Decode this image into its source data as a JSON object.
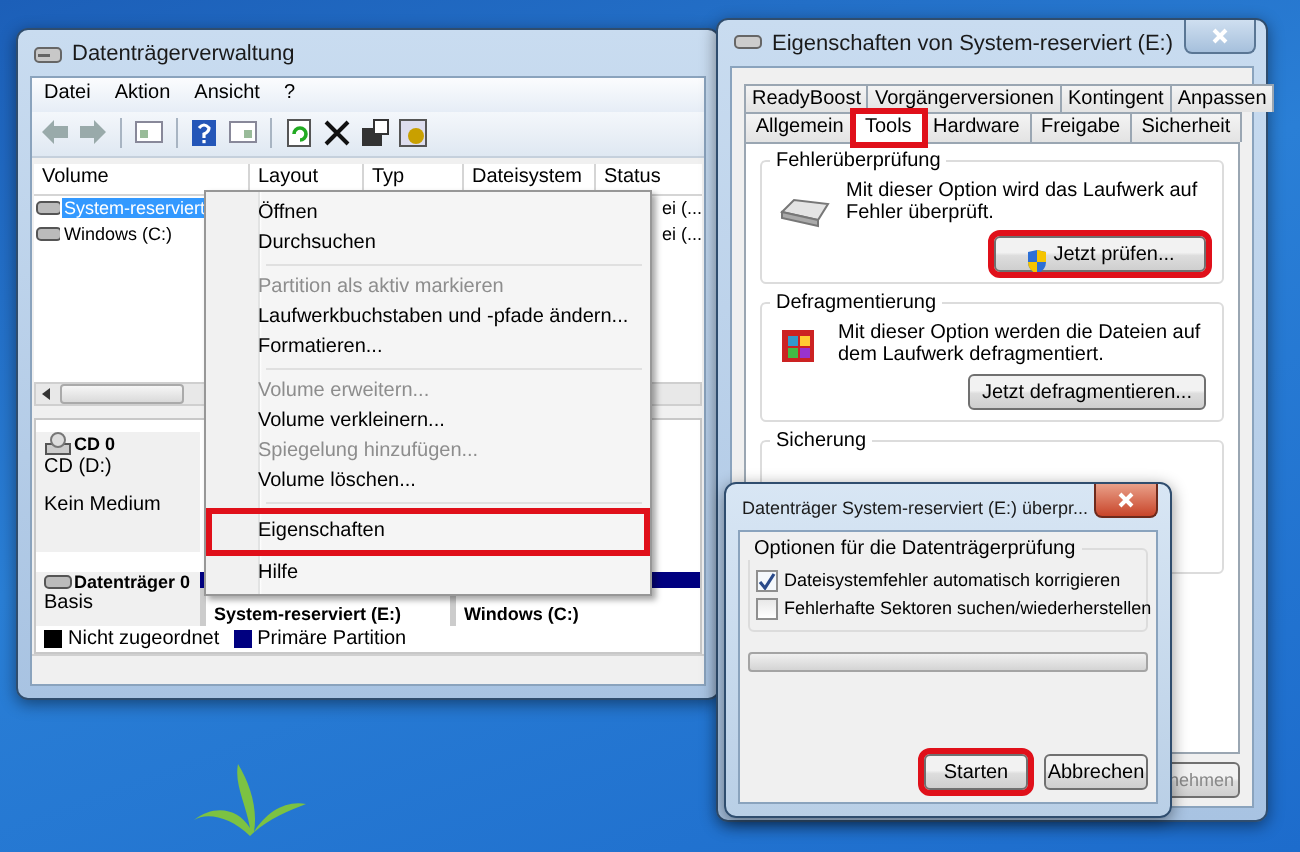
{
  "disk_management": {
    "title": "Datenträgerverwaltung",
    "menu": [
      "Datei",
      "Aktion",
      "Ansicht",
      "?"
    ],
    "table": {
      "columns": [
        "Volume",
        "Layout",
        "Typ",
        "Dateisystem",
        "Status"
      ],
      "rows": [
        {
          "volume": "System-reserviert",
          "status": "ei (...",
          "selected": true
        },
        {
          "volume": "Windows (C:)",
          "status": "ei (...",
          "selected": false
        }
      ]
    },
    "disks": [
      {
        "kind": "cd",
        "name": "CD 0",
        "lines": [
          "CD (D:)",
          "Kein Medium"
        ]
      },
      {
        "kind": "disk",
        "name": "Datenträger 0",
        "lines": [
          "Basis"
        ],
        "partitions": [
          "System-reserviert (E:)",
          "Windows (C:)"
        ]
      }
    ],
    "legend": [
      {
        "label": "Nicht zugeordnet",
        "color": "#000000"
      },
      {
        "label": "Primäre Partition",
        "color": "#000080"
      }
    ]
  },
  "context_menu": {
    "items": [
      {
        "kind": "item",
        "label": "Öffnen",
        "disabled": false,
        "highlighted": false
      },
      {
        "kind": "item",
        "label": "Durchsuchen",
        "disabled": false,
        "highlighted": false
      },
      {
        "kind": "separator"
      },
      {
        "kind": "item",
        "label": "Partition als aktiv markieren",
        "disabled": true,
        "highlighted": false
      },
      {
        "kind": "item",
        "label": "Laufwerkbuchstaben und -pfade ändern...",
        "disabled": false,
        "highlighted": false
      },
      {
        "kind": "item",
        "label": "Formatieren...",
        "disabled": false,
        "highlighted": false
      },
      {
        "kind": "separator"
      },
      {
        "kind": "item",
        "label": "Volume erweitern...",
        "disabled": true,
        "highlighted": false
      },
      {
        "kind": "item",
        "label": "Volume verkleinern...",
        "disabled": false,
        "highlighted": false
      },
      {
        "kind": "item",
        "label": "Spiegelung hinzufügen...",
        "disabled": true,
        "highlighted": false
      },
      {
        "kind": "item",
        "label": "Volume löschen...",
        "disabled": false,
        "highlighted": false
      },
      {
        "kind": "separator"
      },
      {
        "kind": "item",
        "label": "Eigenschaften",
        "disabled": false,
        "highlighted": true
      },
      {
        "kind": "item",
        "label": "Hilfe",
        "disabled": false,
        "highlighted": false
      }
    ]
  },
  "properties": {
    "title": "Eigenschaften von System-reserviert (E:)",
    "tab_rows": [
      [
        {
          "label": "ReadyBoost",
          "selected": false,
          "highlighted": false
        },
        {
          "label": "Vorgängerversionen",
          "selected": false,
          "highlighted": false
        },
        {
          "label": "Kontingent",
          "selected": false,
          "highlighted": false
        },
        {
          "label": "Anpassen",
          "selected": false,
          "highlighted": false
        }
      ],
      [
        {
          "label": "Allgemein",
          "selected": false,
          "highlighted": false
        },
        {
          "label": "Tools",
          "selected": true,
          "highlighted": true
        },
        {
          "label": "Hardware",
          "selected": false,
          "highlighted": false
        },
        {
          "label": "Freigabe",
          "selected": false,
          "highlighted": false
        },
        {
          "label": "Sicherheit",
          "selected": false,
          "highlighted": false
        }
      ]
    ],
    "groups": [
      {
        "kind": "check",
        "title": "Fehlerüberprüfung",
        "text": "Mit dieser Option wird das Laufwerk auf Fehler überprüft.",
        "button": {
          "label": "Jetzt prüfen...",
          "highlighted": true
        }
      },
      {
        "kind": "defrag",
        "title": "Defragmentierung",
        "text": "Mit dieser Option werden die Dateien auf dem Laufwerk defragmentiert.",
        "button": {
          "label": "Jetzt defragmentieren...",
          "highlighted": false
        }
      },
      {
        "kind": "backup",
        "title": "Sicherung"
      }
    ],
    "apply_button": "nehmen"
  },
  "check_dialog": {
    "title": "Datenträger System-reserviert (E:) überpr...",
    "group_title": "Optionen für die Datenträgerprüfung",
    "options": [
      {
        "label": "Dateisystemfehler automatisch korrigieren",
        "checked": true
      },
      {
        "label": "Fehlerhafte Sektoren suchen/wiederherstellen",
        "checked": false
      }
    ],
    "progress": {
      "level": 0
    },
    "buttons": [
      {
        "label": "Starten",
        "highlighted": true
      },
      {
        "label": "Abbrechen",
        "highlighted": false
      }
    ]
  }
}
